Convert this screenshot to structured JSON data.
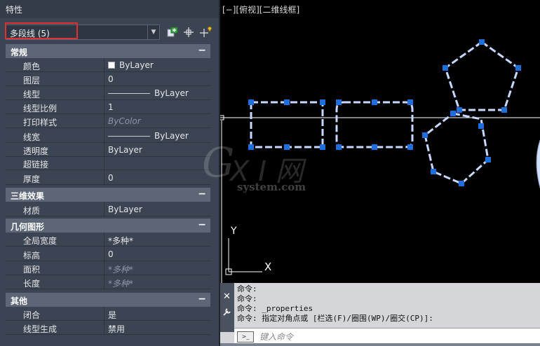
{
  "panel": {
    "title": "特性",
    "selector": {
      "value": "多段线 (5)",
      "arrow": "▼"
    },
    "sections": [
      {
        "label": "常规",
        "collapse": "−",
        "rows": [
          {
            "key": "颜色",
            "value": "ByLayer",
            "glyph": "swatch"
          },
          {
            "key": "图层",
            "value": "0"
          },
          {
            "key": "线型",
            "value": "ByLayer",
            "glyph": "line"
          },
          {
            "key": "线型比例",
            "value": "1"
          },
          {
            "key": "打印样式",
            "value": "ByColor",
            "dim": true
          },
          {
            "key": "线宽",
            "value": "ByLayer",
            "glyph": "line"
          },
          {
            "key": "透明度",
            "value": "ByLayer"
          },
          {
            "key": "超链接",
            "value": ""
          },
          {
            "key": "厚度",
            "value": "0"
          }
        ]
      },
      {
        "label": "三维效果",
        "collapse": "−",
        "rows": [
          {
            "key": "材质",
            "value": "ByLayer"
          }
        ]
      },
      {
        "label": "几何图形",
        "collapse": "−",
        "rows": [
          {
            "key": "全局宽度",
            "value": "*多种*"
          },
          {
            "key": "标高",
            "value": "0"
          },
          {
            "key": "面积",
            "value": "*多种*",
            "dim": true
          },
          {
            "key": "长度",
            "value": "*多种*",
            "dim": true
          }
        ]
      },
      {
        "label": "其他",
        "collapse": "−",
        "rows": [
          {
            "key": "闭合",
            "value": "是"
          },
          {
            "key": "线型生成",
            "value": "禁用"
          }
        ]
      }
    ]
  },
  "viewport": {
    "label": "[−][俯视][二维线框]",
    "axis_y": "Y",
    "axis_x": "X",
    "watermark": {
      "g": "G",
      "xi": "X I 网",
      "site": "system.com"
    }
  },
  "command": {
    "lines": [
      "命令:",
      "命令:",
      "命令: _properties",
      "命令: 指定对角点或 [栏选(F)/圈围(WP)/圈交(CP)]:"
    ],
    "placeholder": "键入命令",
    "close": "✕",
    "prompt_icon": ">_"
  },
  "colors": {
    "panel_bg": "#3b4453",
    "section_bg": "#5c6676",
    "highlight": "#e03030",
    "grip": "#1e6fdc",
    "polyline": "#d8e6ff"
  }
}
